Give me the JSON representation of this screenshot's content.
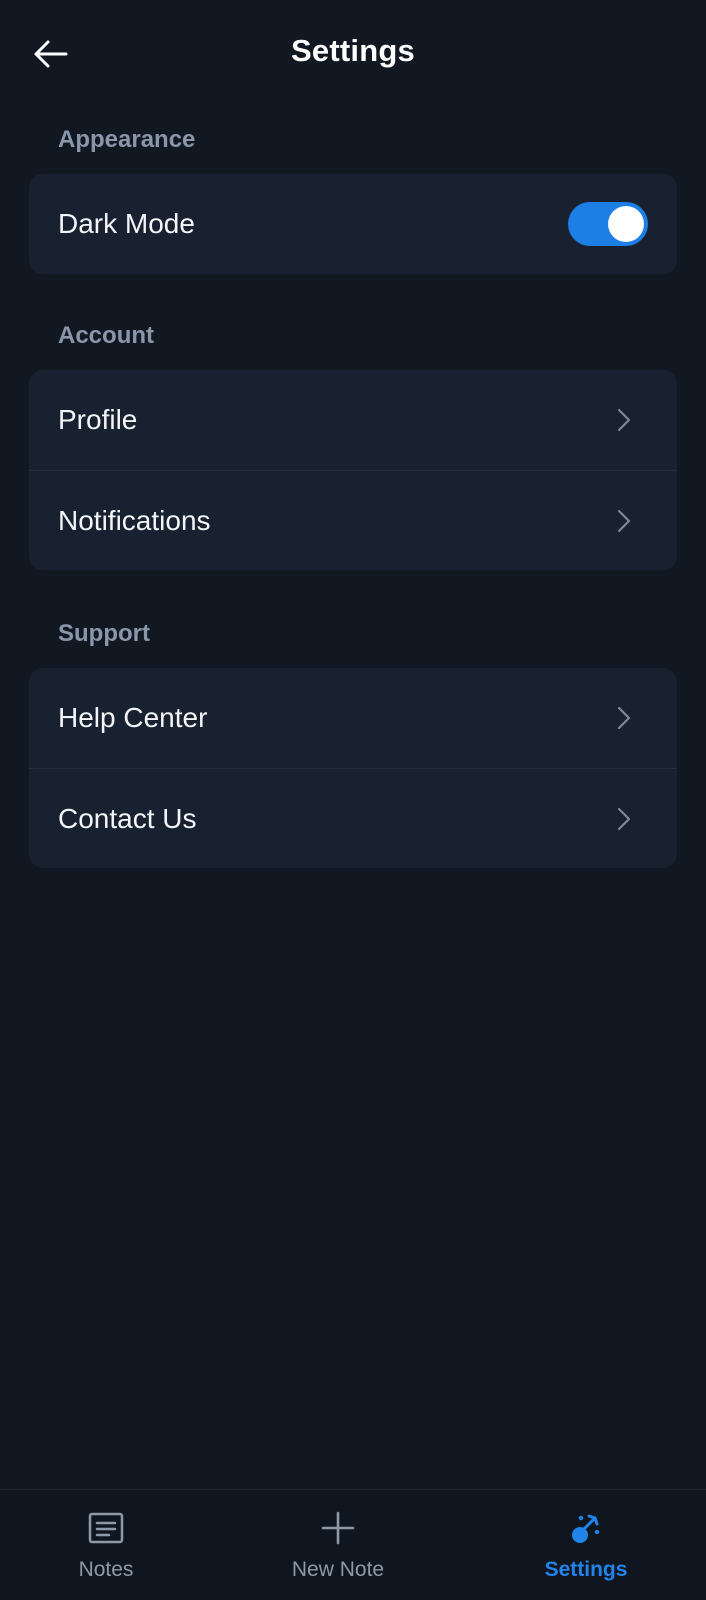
{
  "header": {
    "title": "Settings",
    "back_icon": "arrow-left-icon"
  },
  "sections": [
    {
      "label": "Appearance",
      "items": [
        {
          "label": "Dark Mode",
          "control": "toggle",
          "value": true
        }
      ]
    },
    {
      "label": "Account",
      "items": [
        {
          "label": "Profile",
          "control": "chevron"
        },
        {
          "label": "Notifications",
          "control": "chevron"
        }
      ]
    },
    {
      "label": "Support",
      "items": [
        {
          "label": "Help Center",
          "control": "chevron"
        },
        {
          "label": "Contact Us",
          "control": "chevron"
        }
      ]
    }
  ],
  "bottom_nav": {
    "items": [
      {
        "label": "Notes",
        "icon": "notes-icon",
        "active": false
      },
      {
        "label": "New Note",
        "icon": "plus-icon",
        "active": false
      },
      {
        "label": "Settings",
        "icon": "settings-icon",
        "active": true
      }
    ]
  },
  "colors": {
    "background": "#111822",
    "card": "#18212f",
    "accent": "#1d7fe6",
    "section_label": "#8a97aa",
    "nav_inactive": "#8e99a8"
  }
}
